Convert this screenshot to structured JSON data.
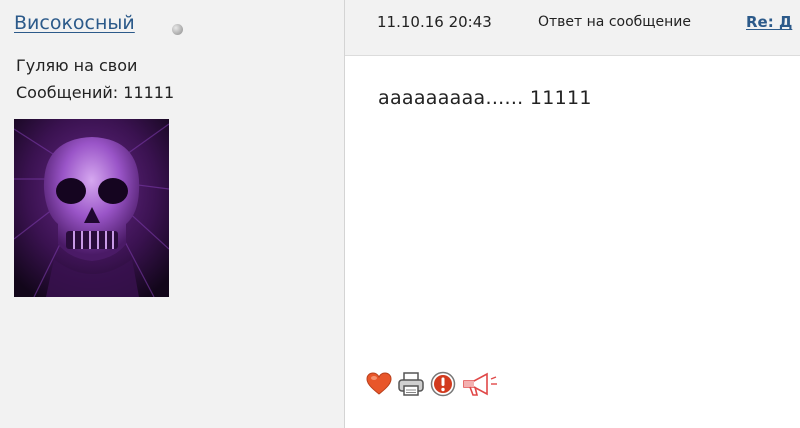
{
  "author": {
    "username": "Високосный",
    "status": "offline",
    "title": "Гуляю на свои",
    "posts_label": "Сообщений: 11111",
    "avatar_icon": "skull-avatar"
  },
  "post": {
    "datetime": "11.10.16 20:43",
    "reply_label": "Ответ на сообщение",
    "subject_link": "Re: Д",
    "body": "ааааааааа...... 11111"
  },
  "actions": [
    {
      "icon": "heart-icon",
      "color": "#e8562a"
    },
    {
      "icon": "printer-icon",
      "color": "#555555"
    },
    {
      "icon": "report-icon",
      "color": "#d23a1e"
    },
    {
      "icon": "megaphone-icon",
      "color": "#e04848"
    }
  ],
  "colors": {
    "link": "#2c5a8a",
    "sidebar_bg": "#f2f2f2",
    "border": "#d4d4d4"
  }
}
